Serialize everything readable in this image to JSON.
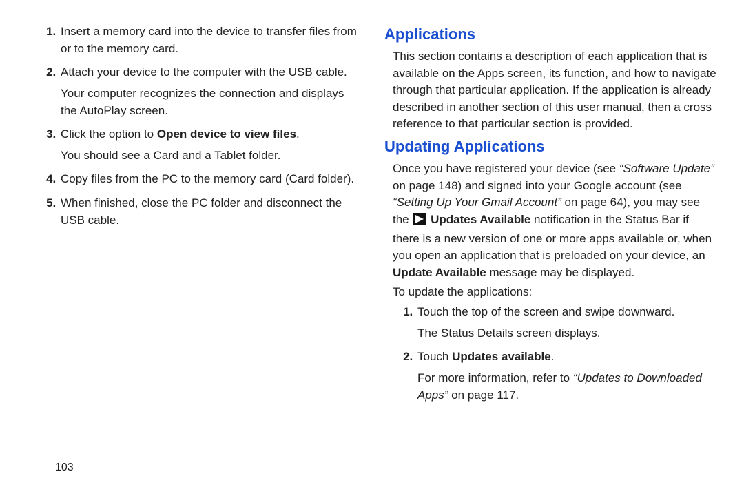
{
  "left": {
    "steps": [
      {
        "n": "1.",
        "text": "Insert a memory card into the device to transfer files from or to the memory card."
      },
      {
        "n": "2.",
        "text": "Attach your device to the computer with the USB cable.",
        "sub": "Your computer recognizes the connection and displays the AutoPlay screen."
      },
      {
        "n": "3.",
        "pre": "Click the option to ",
        "bold": "Open device to view files",
        "post": ".",
        "sub": "You should see a Card and a Tablet folder."
      },
      {
        "n": "4.",
        "text": "Copy files from the PC to the memory card (Card folder)."
      },
      {
        "n": "5.",
        "text": "When finished, close the PC folder and disconnect the USB cable."
      }
    ]
  },
  "right": {
    "h_applications": "Applications",
    "applications_body": "This section contains a description of each application that is available on the Apps screen, its function, and how to navigate through that particular application. If the application is already described in another section of this user manual, then a cross reference to that particular section is provided.",
    "h_updating": "Updating Applications",
    "upd_p_pre": "Once you have registered your device (see ",
    "upd_p_ref1": "“Software Update”",
    "upd_p_mid1": " on page 148) and signed into your Google account (see ",
    "upd_p_ref2": "“Setting Up Your Gmail Account”",
    "upd_p_mid2": " on page 64), you may see the ",
    "upd_p_bold1": "Updates Available",
    "upd_p_mid3": " notification in the Status Bar if there is a new version of one or more apps available or, when you open an application that is preloaded on your device, an ",
    "upd_p_bold2": "Update Available",
    "upd_p_post": " message may be displayed.",
    "lead": "To update the applications:",
    "steps": [
      {
        "n": "1.",
        "text": "Touch the top of the screen and swipe downward.",
        "sub": "The Status Details screen displays."
      },
      {
        "n": "2.",
        "pre": "Touch ",
        "bold": "Updates available",
        "post": ".",
        "sub_pre": "For more information, refer to ",
        "sub_ital": "“Updates to Downloaded Apps”",
        "sub_post": " on page 117."
      }
    ]
  },
  "pagenum": "103"
}
